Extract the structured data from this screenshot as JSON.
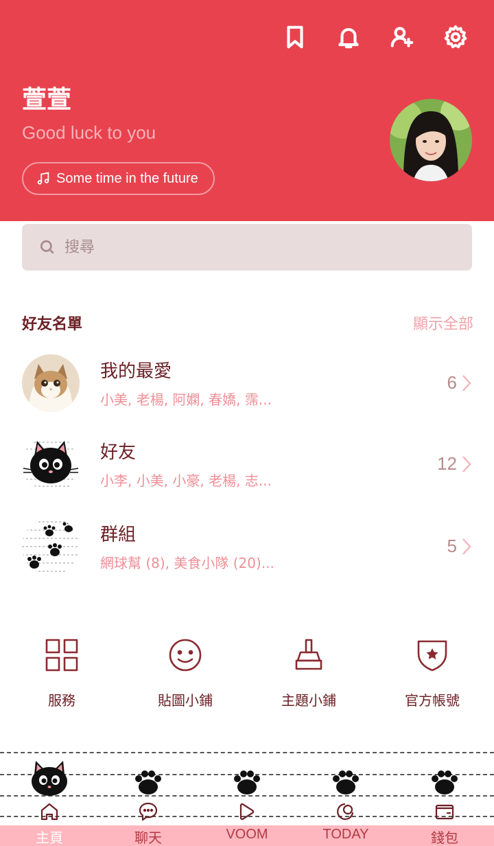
{
  "header": {
    "icons": [
      "bookmark-icon",
      "bell-icon",
      "add-friend-icon",
      "gear-icon"
    ],
    "name": "萱萱",
    "status_message": "Good luck to you",
    "music_label": "Some time in the future"
  },
  "search": {
    "placeholder": "搜尋"
  },
  "friends": {
    "title": "好友名單",
    "show_all": "顯示全部",
    "rows": [
      {
        "title": "我的最愛",
        "members": "小美, 老楊, 阿嫻, 春嬌, 霈...",
        "count": "6"
      },
      {
        "title": "好友",
        "members": "小李, 小美, 小豪, 老楊, 志...",
        "count": "12"
      },
      {
        "title": "群組",
        "members": "網球幫 (8), 美食小隊 (20)...",
        "count": "5"
      }
    ]
  },
  "services": [
    {
      "label": "服務",
      "icon": "grid-icon"
    },
    {
      "label": "貼圖小鋪",
      "icon": "smiley-icon"
    },
    {
      "label": "主題小鋪",
      "icon": "brush-icon"
    },
    {
      "label": "官方帳號",
      "icon": "shield-star-icon"
    }
  ],
  "nav": {
    "tabs": [
      {
        "label": "主頁",
        "icon": "home-icon",
        "active": true
      },
      {
        "label": "聊天",
        "icon": "chat-icon",
        "active": false
      },
      {
        "label": "VOOM",
        "icon": "voom-play-icon",
        "active": false
      },
      {
        "label": "TODAY",
        "icon": "today-icon",
        "active": false
      },
      {
        "label": "錢包",
        "icon": "wallet-icon",
        "active": false
      }
    ]
  },
  "colors": {
    "header_bg": "#e8424f",
    "accent_pink": "#ffb7bf",
    "text_dark": "#6b1f24"
  }
}
